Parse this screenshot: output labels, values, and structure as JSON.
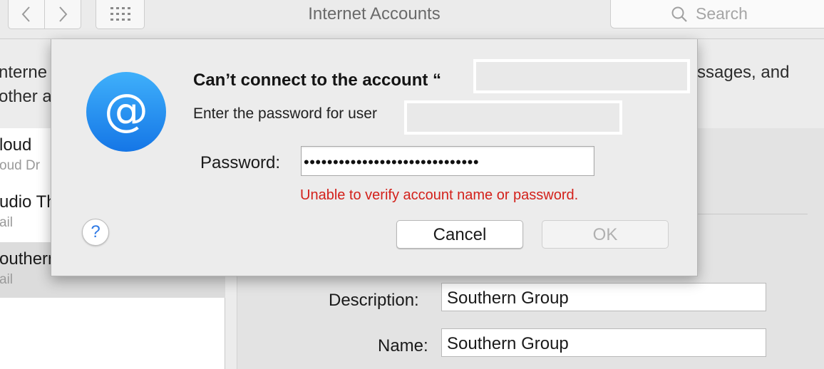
{
  "toolbar": {
    "back_icon": "chevron-left-icon",
    "forward_icon": "chevron-right-icon",
    "grid_icon": "grid-icon",
    "title": "Internet Accounts",
    "search_placeholder": "Search"
  },
  "background": {
    "description_fragments": [
      "nterne",
      "ssages, and",
      "other a"
    ],
    "accounts": [
      {
        "name": "loud",
        "sub": "oud Dr",
        "selected": false
      },
      {
        "name": "udio Th",
        "sub": "ail",
        "selected": false
      },
      {
        "name": "outhern",
        "sub": "ail",
        "selected": true
      }
    ],
    "fields": {
      "description_label": "Description:",
      "description_value": "Southern Group",
      "name_label": "Name:",
      "name_value": "Southern Group"
    }
  },
  "dialog": {
    "icon": "at-sign-icon",
    "title": "Can’t connect to the account “",
    "subtitle": "Enter the password for user",
    "password_label": "Password:",
    "password_value": "••••••••••••••••••••••••••••••",
    "error": "Unable to verify account name or password.",
    "help_label": "?",
    "cancel_label": "Cancel",
    "ok_label": "OK"
  },
  "colors": {
    "error": "#d3211b",
    "accent_blue": "#2f7ae5",
    "icon_blue": "#1f8ef1"
  }
}
